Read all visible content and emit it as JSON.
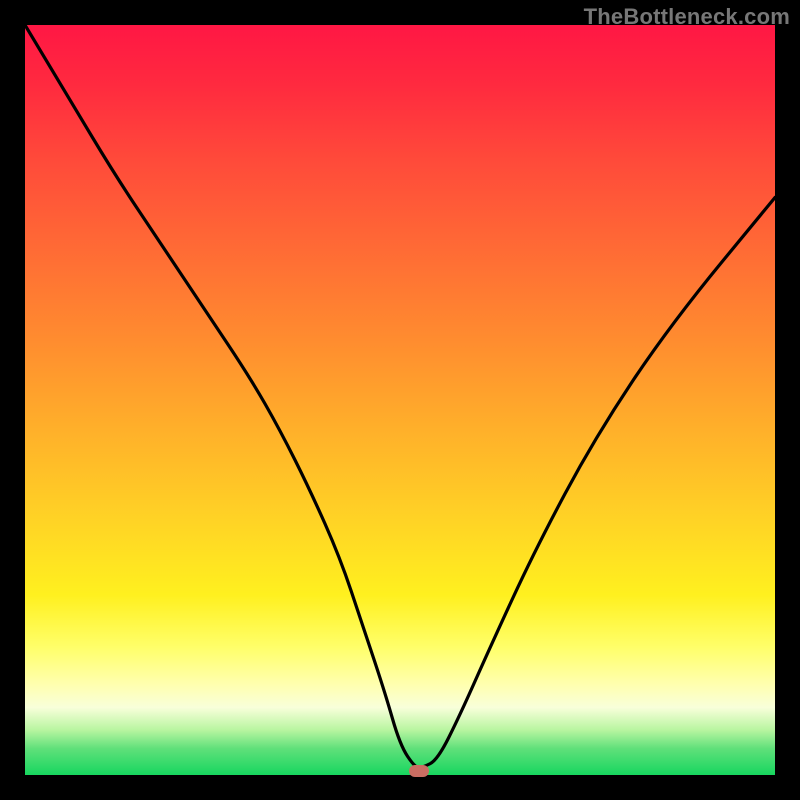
{
  "watermark": "TheBottleneck.com",
  "chart_data": {
    "type": "line",
    "title": "",
    "xlabel": "",
    "ylabel": "",
    "xlim": [
      0,
      100
    ],
    "ylim": [
      0,
      100
    ],
    "grid": false,
    "series": [
      {
        "name": "bottleneck-curve",
        "x": [
          0,
          6,
          12,
          18,
          24,
          30,
          34,
          38,
          42,
          45,
          48,
          50,
          52,
          53,
          55,
          58,
          62,
          68,
          76,
          86,
          100
        ],
        "values": [
          100,
          90,
          80,
          71,
          62,
          53,
          46,
          38,
          29,
          20,
          11,
          4,
          1,
          1,
          2,
          8,
          17,
          30,
          45,
          60,
          77
        ]
      }
    ],
    "marker": {
      "x": 52.5,
      "y": 0.5,
      "color": "#c96d62"
    },
    "background_gradient": {
      "direction": "vertical",
      "stops": [
        {
          "pos": 0,
          "color": "#ff1744"
        },
        {
          "pos": 50,
          "color": "#ffb02a"
        },
        {
          "pos": 80,
          "color": "#ffff6a"
        },
        {
          "pos": 100,
          "color": "#17d65f"
        }
      ]
    }
  }
}
